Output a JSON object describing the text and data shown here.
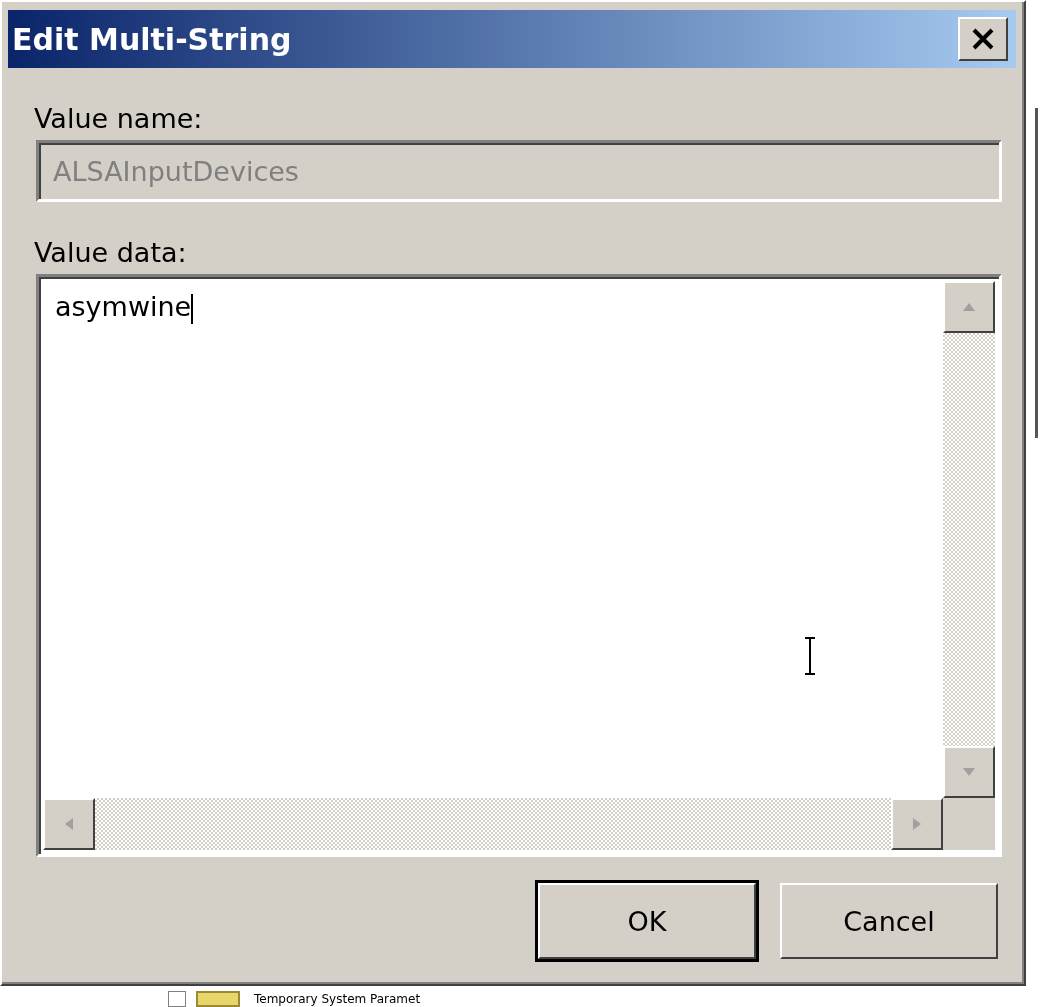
{
  "window": {
    "title": "Edit Multi-String"
  },
  "value_name": {
    "label": "Value name:",
    "value": "ALSAInputDevices",
    "disabled": true
  },
  "value_data": {
    "label": "Value data:",
    "value": "asymwine"
  },
  "buttons": [
    {
      "label": "OK",
      "default": true
    },
    {
      "label": "Cancel",
      "default": false
    }
  ],
  "background": {
    "tree_item": "Temporary System Paramet"
  }
}
